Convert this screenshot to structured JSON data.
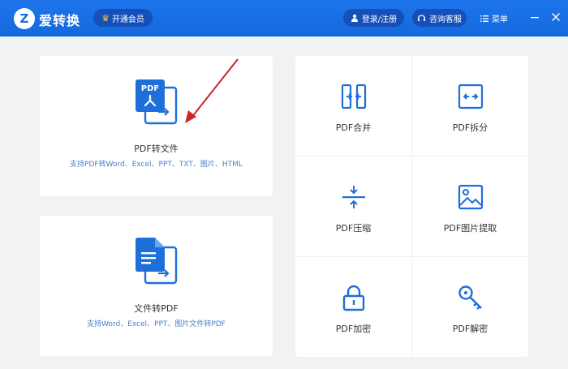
{
  "app": {
    "logo_letter": "Z",
    "title": "爱转换",
    "vip_label": "开通会员"
  },
  "header": {
    "login_label": "登录/注册",
    "service_label": "咨询客服",
    "menu_label": "菜单"
  },
  "cards": {
    "pdf_to_file": {
      "title": "PDF转文件",
      "desc": "支持PDF转Word、Excel、PPT、TXT、图片、HTML",
      "icon_text": "PDF"
    },
    "file_to_pdf": {
      "title": "文件转PDF",
      "desc": "支持Word、Excel、PPT、图片文件转PDF"
    }
  },
  "tools": [
    {
      "label": "PDF合并",
      "icon": "merge-icon"
    },
    {
      "label": "PDF拆分",
      "icon": "split-icon"
    },
    {
      "label": "PDF压缩",
      "icon": "compress-icon"
    },
    {
      "label": "PDF图片提取",
      "icon": "image-extract-icon"
    },
    {
      "label": "PDF加密",
      "icon": "lock-icon"
    },
    {
      "label": "PDF解密",
      "icon": "key-icon"
    }
  ],
  "colors": {
    "brand_blue": "#1a73e8",
    "icon_blue": "#1e6fd9",
    "annotation_red": "#c8262a"
  }
}
